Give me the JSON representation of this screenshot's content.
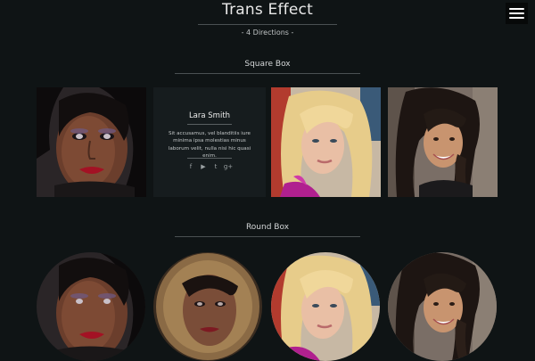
{
  "header": {
    "title": "Trans Effect",
    "subtitle": "- 4 Directions -",
    "menu_icon": "hamburger-menu-icon"
  },
  "sections": {
    "square": {
      "heading": "Square Box"
    },
    "round": {
      "heading": "Round Box"
    }
  },
  "square_hover_card": {
    "name": "Lara Smith",
    "description": "Sit accusamus, vel blanditiis iure minima ipsa molestias minus laborum velit, nulla nisi hic quasi enim.",
    "social_icons": [
      "facebook-icon",
      "youtube-icon",
      "twitter-icon",
      "google-plus-icon"
    ],
    "social_glyphs": [
      "f",
      "▶",
      "t",
      "g+"
    ]
  },
  "square_tiles": [
    "portrait-woman-dark-hair",
    "hover-card",
    "portrait-blonde-woman",
    "portrait-smiling-woman-braid"
  ],
  "round_tiles": [
    "portrait-woman-dark-hair",
    "portrait-woman-fur-hood",
    "portrait-blonde-woman",
    "portrait-smiling-woman-braid"
  ]
}
